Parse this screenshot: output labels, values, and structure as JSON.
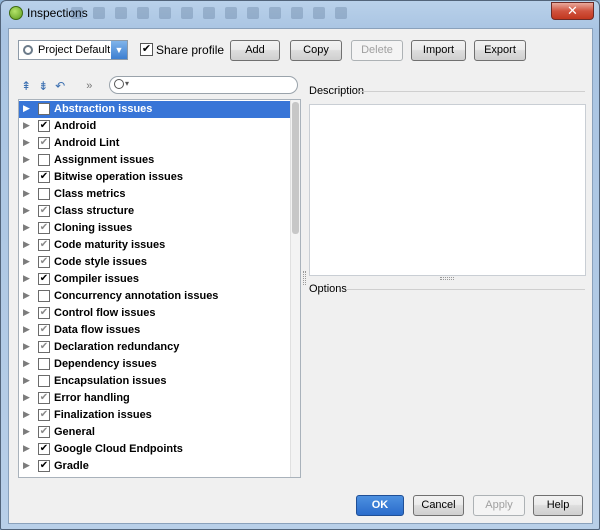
{
  "window": {
    "title": "Inspections",
    "close_glyph": "✕"
  },
  "toolbar": {
    "profile_value": "Project Default",
    "share_profile_label": "Share profile",
    "share_profile_checked": true,
    "add_label": "Add",
    "copy_label": "Copy",
    "delete_label": "Delete",
    "import_label": "Import",
    "export_label": "Export"
  },
  "tree_tools": {
    "expand_all": "⇞",
    "collapse_all": "⇟",
    "reset": "↶",
    "more": "»"
  },
  "search": {
    "placeholder": ""
  },
  "inspections": [
    {
      "label": "Abstraction issues",
      "state": "unchecked",
      "selected": true
    },
    {
      "label": "Android",
      "state": "checked"
    },
    {
      "label": "Android Lint",
      "state": "partial"
    },
    {
      "label": "Assignment issues",
      "state": "unchecked"
    },
    {
      "label": "Bitwise operation issues",
      "state": "checked"
    },
    {
      "label": "Class metrics",
      "state": "unchecked"
    },
    {
      "label": "Class structure",
      "state": "partial"
    },
    {
      "label": "Cloning issues",
      "state": "partial"
    },
    {
      "label": "Code maturity issues",
      "state": "partial"
    },
    {
      "label": "Code style issues",
      "state": "partial"
    },
    {
      "label": "Compiler issues",
      "state": "checked"
    },
    {
      "label": "Concurrency annotation issues",
      "state": "unchecked"
    },
    {
      "label": "Control flow issues",
      "state": "partial"
    },
    {
      "label": "Data flow issues",
      "state": "partial"
    },
    {
      "label": "Declaration redundancy",
      "state": "partial"
    },
    {
      "label": "Dependency issues",
      "state": "unchecked"
    },
    {
      "label": "Encapsulation issues",
      "state": "unchecked"
    },
    {
      "label": "Error handling",
      "state": "partial"
    },
    {
      "label": "Finalization issues",
      "state": "partial"
    },
    {
      "label": "General",
      "state": "partial"
    },
    {
      "label": "Google Cloud Endpoints",
      "state": "checked"
    },
    {
      "label": "Gradle",
      "state": "checked"
    }
  ],
  "panels": {
    "description_title": "Description",
    "options_title": "Options"
  },
  "footer": {
    "ok_label": "OK",
    "cancel_label": "Cancel",
    "apply_label": "Apply",
    "help_label": "Help"
  },
  "colors": {
    "selection": "#3875d7",
    "primary_button": "#2a6ccb"
  }
}
